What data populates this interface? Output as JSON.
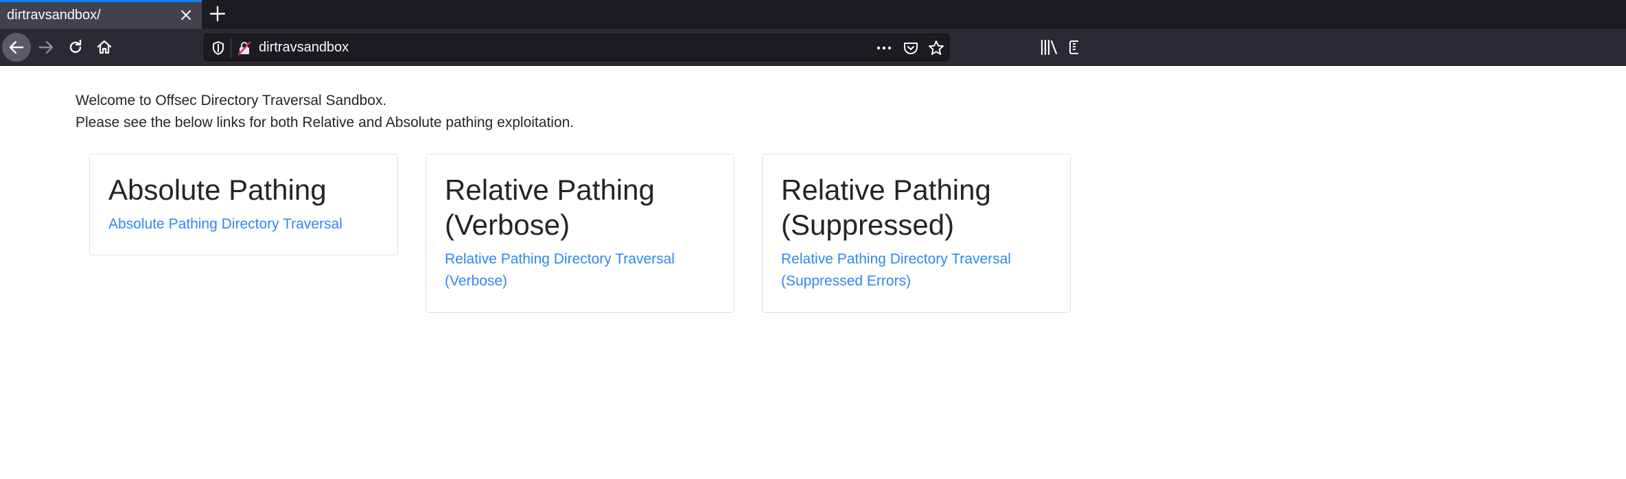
{
  "browser": {
    "tab": {
      "title": "dirtravsandbox/"
    },
    "url": "dirtravsandbox",
    "icons": {
      "tab_close": "close-icon",
      "new_tab": "plus-icon",
      "back": "arrow-left-icon",
      "forward": "arrow-right-icon",
      "reload": "reload-icon",
      "home": "home-icon",
      "shield": "shield-icon",
      "insecure": "insecure-lock-icon",
      "more": "ellipsis-icon",
      "pocket": "pocket-icon",
      "bookmark": "star-icon",
      "library": "library-icon",
      "sidebar": "sidebar-icon"
    }
  },
  "page": {
    "intro_line1": "Welcome to Offsec Directory Traversal Sandbox.",
    "intro_line2": "Please see the below links for both Relative and Absolute pathing exploitation.",
    "cards": [
      {
        "title": "Absolute Pathing",
        "link": "Absolute Pathing Directory Traversal"
      },
      {
        "title": "Relative Pathing (Verbose)",
        "link": "Relative Pathing Directory Traversal (Verbose)"
      },
      {
        "title": "Relative Pathing (Suppressed)",
        "link": "Relative Pathing Directory Traversal (Suppressed Errors)"
      }
    ]
  },
  "colors": {
    "link": "#2f86f6",
    "text": "#212529",
    "tab_accent": "#0a84ff",
    "chrome_dark": "#1c1b22",
    "toolbar": "#2b2a33"
  }
}
